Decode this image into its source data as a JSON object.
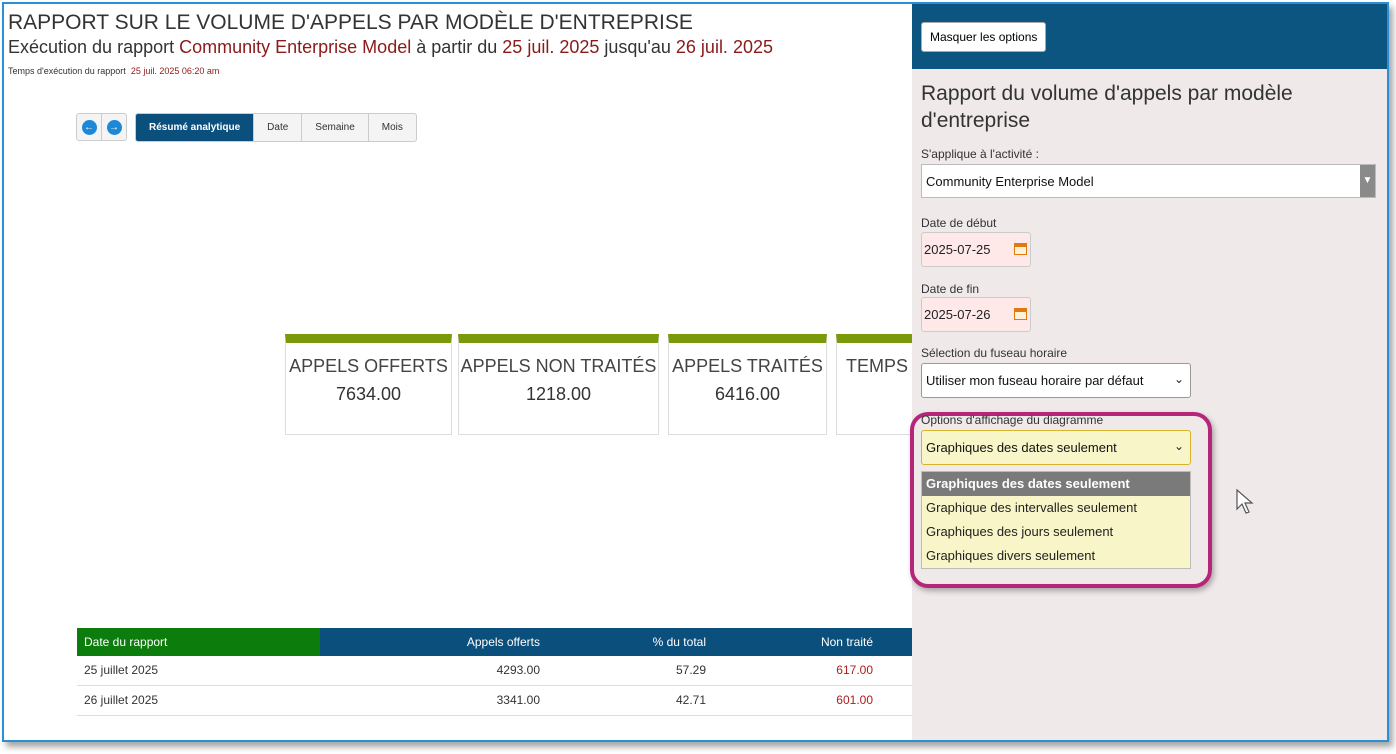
{
  "report": {
    "title": "RAPPORT SUR LE VOLUME D'APPELS PAR MODÈLE D'ENTREPRISE",
    "subtitle_prefix": "Exécution du rapport",
    "model": "Community Enterprise Model",
    "from_text": "à partir du",
    "start_date": "25 juil. 2025",
    "until_text": "jusqu'au",
    "end_date": "26 juil. 2025",
    "exec_label": "Temps d'exécution du rapport",
    "exec_time": "25 juil. 2025 06:20 am"
  },
  "nav": {
    "prev_icon": "arrow-left-icon",
    "next_icon": "arrow-right-icon",
    "tabs": [
      "Résumé analytique",
      "Date",
      "Semaine",
      "Mois"
    ],
    "active_tab": "Résumé analytique"
  },
  "kpis": [
    {
      "label": "APPELS OFFERTS",
      "value": "7634.00"
    },
    {
      "label": "APPELS NON TRAITÉS",
      "value": "1218.00"
    },
    {
      "label": "APPELS TRAITÉS",
      "value": "6416.00"
    },
    {
      "label": "TEMPS I",
      "value": ""
    }
  ],
  "table": {
    "headers": [
      "Date du rapport",
      "Appels offerts",
      "% du total",
      "Non traité"
    ],
    "rows": [
      [
        "25 juillet 2025",
        "4293.00",
        "57.29",
        "617.00"
      ],
      [
        "26 juillet 2025",
        "3341.00",
        "42.71",
        "601.00"
      ]
    ]
  },
  "panel": {
    "hide_button": "Masquer les options",
    "title": "Rapport du volume d'appels par modèle d'entreprise",
    "activity_label": "S'applique à l'activité :",
    "activity_value": "Community Enterprise Model",
    "start_label": "Date de début",
    "start_value": "2025-07-25",
    "end_label": "Date de fin",
    "end_value": "2025-07-26",
    "timezone_label": "Sélection du fuseau horaire",
    "timezone_value": "Utiliser mon fuseau horaire par défaut",
    "chart_label": "Options d'affichage du diagramme",
    "chart_value": "Graphiques des dates seulement",
    "chart_options": [
      "Graphiques des dates seulement",
      "Graphique des intervalles seulement",
      "Graphiques des jours seulement",
      "Graphiques divers seulement"
    ]
  },
  "colors": {
    "accent_blue": "#0b4f7c",
    "kpi_green": "#7a9a0a",
    "highlight": "#b5267a",
    "table_date_header": "#0c7d0c"
  }
}
